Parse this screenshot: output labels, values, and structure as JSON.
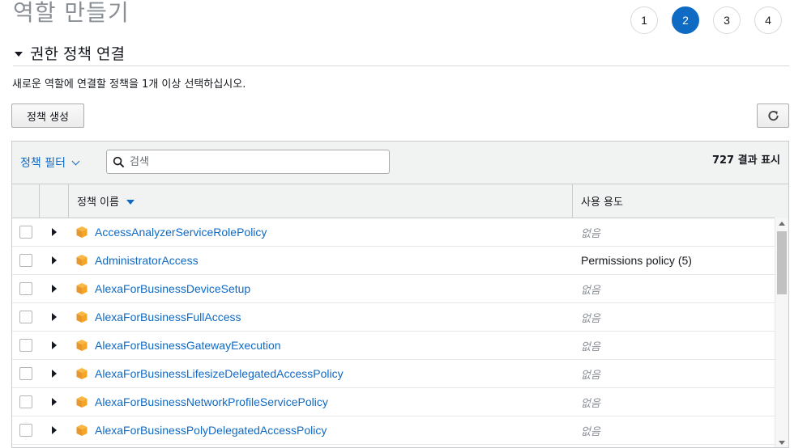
{
  "page_title": "역할 만들기",
  "steps": [
    {
      "label": "1",
      "active": false
    },
    {
      "label": "2",
      "active": true
    },
    {
      "label": "3",
      "active": false
    },
    {
      "label": "4",
      "active": false
    }
  ],
  "section": {
    "title": "권한 정책 연결"
  },
  "description": "새로운 역할에 연결할 정책을 1개 이상 선택하십시오.",
  "toolbar": {
    "create_label": "정책 생성",
    "refresh_icon": "refresh-icon"
  },
  "filter": {
    "label": "정책 필터",
    "search_placeholder": "검색",
    "count_text": "727 결과 표시"
  },
  "table": {
    "col_name": "정책 이름",
    "col_usage": "사용 용도",
    "rows": [
      {
        "name": "AccessAnalyzerServiceRolePolicy",
        "usage": "없음",
        "none": true
      },
      {
        "name": "AdministratorAccess",
        "usage": "Permissions policy (5)",
        "none": false
      },
      {
        "name": "AlexaForBusinessDeviceSetup",
        "usage": "없음",
        "none": true
      },
      {
        "name": "AlexaForBusinessFullAccess",
        "usage": "없음",
        "none": true
      },
      {
        "name": "AlexaForBusinessGatewayExecution",
        "usage": "없음",
        "none": true
      },
      {
        "name": "AlexaForBusinessLifesizeDelegatedAccessPolicy",
        "usage": "없음",
        "none": true
      },
      {
        "name": "AlexaForBusinessNetworkProfileServicePolicy",
        "usage": "없음",
        "none": true
      },
      {
        "name": "AlexaForBusinessPolyDelegatedAccessPolicy",
        "usage": "없음",
        "none": true
      }
    ]
  },
  "colors": {
    "accent": "#0f6ac4",
    "package_icon": "#f39c12"
  }
}
